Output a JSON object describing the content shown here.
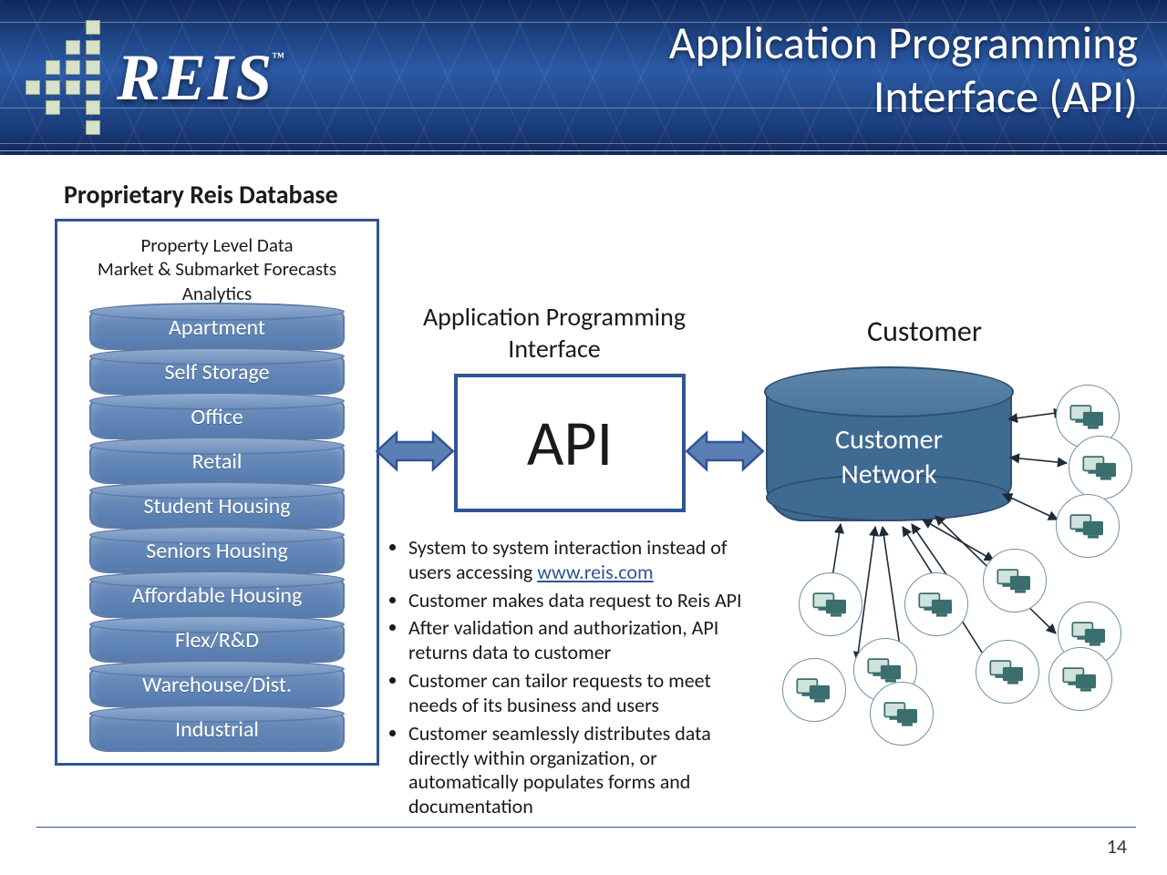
{
  "brand": "REIS",
  "title_line1": "Application Programming",
  "title_line2": "Interface (API)",
  "db_title": "Proprietary Reis Database",
  "db_sub1": "Property Level Data",
  "db_sub2": "Market & Submarket Forecasts",
  "db_sub3": "Analytics",
  "cylinders": [
    "Apartment",
    "Self Storage",
    "Office",
    "Retail",
    "Student Housing",
    "Seniors Housing",
    "Affordable Housing",
    "Flex/R&D",
    "Warehouse/Dist.",
    "Industrial"
  ],
  "center_title": "Application Programming Interface",
  "api_label": "API",
  "bullets_pre": "System to system interaction instead of users accessing ",
  "bullets_link": "www.reis.com",
  "bullets_rest": [
    "Customer makes data request to Reis API",
    "After validation and authorization, API returns data to customer",
    "Customer can tailor requests to meet needs of its business and users",
    "Customer seamlessly distributes data directly within organization, or automatically populates forms and documentation"
  ],
  "customer_title": "Customer",
  "customer_label_1": "Customer",
  "customer_label_2": "Network",
  "page": "14"
}
